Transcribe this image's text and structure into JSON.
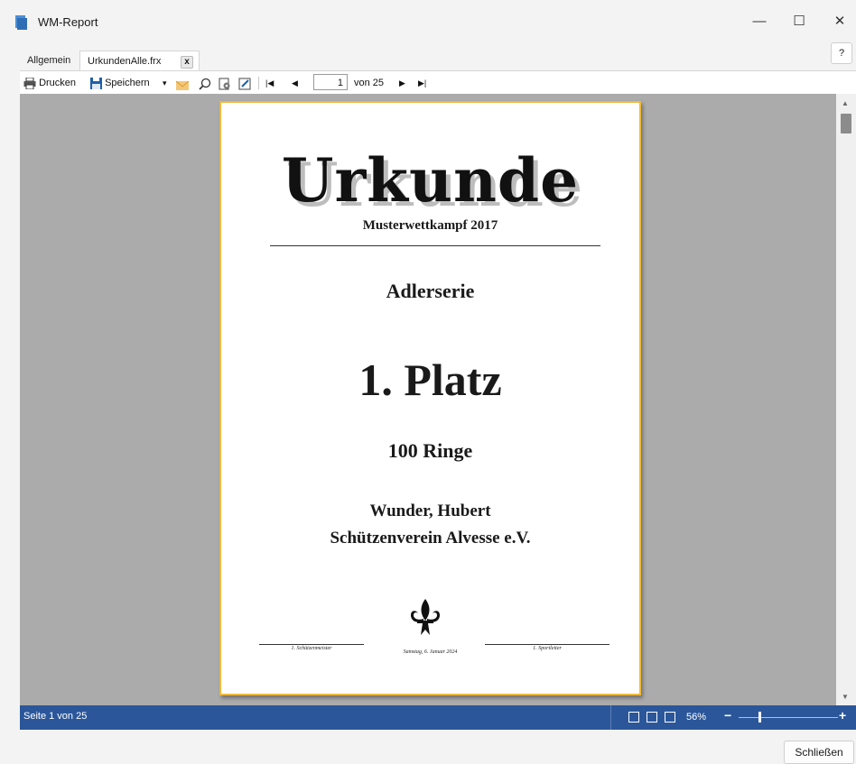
{
  "window": {
    "title": "WM-Report",
    "minimize_glyph": "—",
    "maximize_glyph": "☐",
    "close_glyph": "✕",
    "help_label": "?"
  },
  "tabs": [
    {
      "label": "Allgemein",
      "active": false
    },
    {
      "label": "UrkundenAlle.frx",
      "active": true
    }
  ],
  "tab_close_glyph": "x",
  "toolbar": {
    "print_label": "Drucken",
    "save_label": "Speichern",
    "dropdown_glyph": "▾",
    "first_glyph": "|◀",
    "prev_glyph": "◀",
    "next_glyph": "▶",
    "last_glyph": "▶|",
    "page_value": "1",
    "page_total": "von 25"
  },
  "certificate": {
    "title": "Urkunde",
    "subtitle": "Musterwettkampf 2017",
    "discipline": "Adlerserie",
    "place": "1. Platz",
    "score": "100 Ringe",
    "name": "Wunder, Hubert",
    "club": "Schützenverein Alvesse e.V.",
    "sig_left": "1. Schützenmeister",
    "sig_right": "1. Sportleiter",
    "date": "Samstag, 6. Januar 2024"
  },
  "status": {
    "page_text": "Seite 1 von 25",
    "zoom": "56%",
    "zoom_fraction": 0.2,
    "zoom_minus": "−",
    "zoom_plus": "+"
  },
  "footer": {
    "close_label": "Schließen"
  },
  "colors": {
    "accent": "#2b579a",
    "page_border": "#f0b93a",
    "viewer_bg": "#ababab"
  }
}
